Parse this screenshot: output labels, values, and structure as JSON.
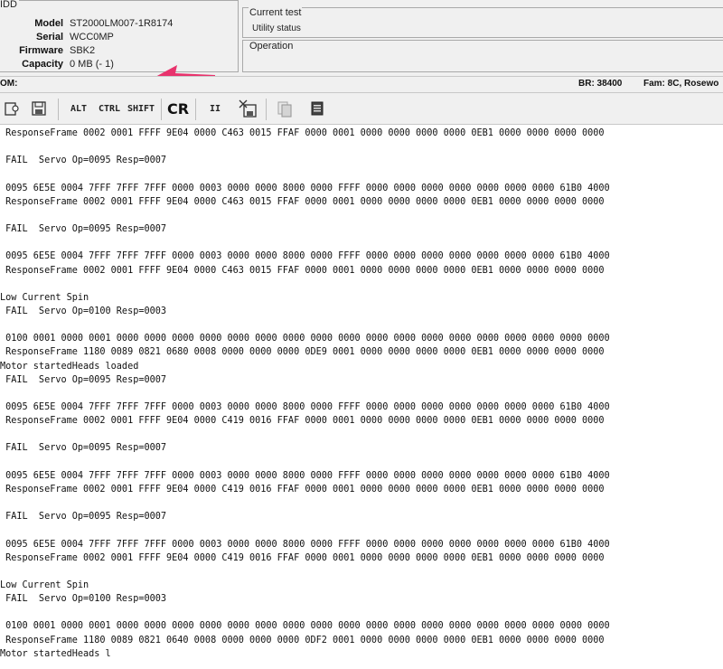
{
  "hdd": {
    "title": "IDD",
    "fields": [
      {
        "label": "Model",
        "value": "ST2000LM007-1R8174"
      },
      {
        "label": "Serial",
        "value": "WCC0MP"
      },
      {
        "label": "Firmware",
        "value": "SBK2"
      },
      {
        "label": "Capacity",
        "value": "0 MB (-      1)"
      }
    ]
  },
  "current_test": {
    "title": "Current test",
    "status": "Utility status"
  },
  "operation": {
    "title": "Operation"
  },
  "status_bar": {
    "com": "OM:",
    "br": "BR: 38400",
    "fam": "Fam: 8C, Rosewo"
  },
  "toolbar": {
    "alt": "ALT",
    "ctrl": "CTRL",
    "shift": "SHIFT",
    "cr": "CR",
    "pause": "II"
  },
  "colors": {
    "arrow": "#e8336d",
    "panel_bg": "#f0f0f0"
  },
  "log": [
    " ResponseFrame 0002 0001 FFFF 9E04 0000 C463 0015 FFAF 0000 0001 0000 0000 0000 0000 0EB1 0000 0000 0000 0000",
    "",
    " FAIL  Servo Op=0095 Resp=0007",
    "",
    " 0095 6E5E 0004 7FFF 7FFF 7FFF 0000 0003 0000 0000 8000 0000 FFFF 0000 0000 0000 0000 0000 0000 0000 61B0 4000",
    " ResponseFrame 0002 0001 FFFF 9E04 0000 C463 0015 FFAF 0000 0001 0000 0000 0000 0000 0EB1 0000 0000 0000 0000",
    "",
    " FAIL  Servo Op=0095 Resp=0007",
    "",
    " 0095 6E5E 0004 7FFF 7FFF 7FFF 0000 0003 0000 0000 8000 0000 FFFF 0000 0000 0000 0000 0000 0000 0000 61B0 4000",
    " ResponseFrame 0002 0001 FFFF 9E04 0000 C463 0015 FFAF 0000 0001 0000 0000 0000 0000 0EB1 0000 0000 0000 0000",
    "",
    "Low Current Spin",
    " FAIL  Servo Op=0100 Resp=0003",
    "",
    " 0100 0001 0000 0001 0000 0000 0000 0000 0000 0000 0000 0000 0000 0000 0000 0000 0000 0000 0000 0000 0000 0000",
    " ResponseFrame 1180 0089 0821 0680 0008 0000 0000 0000 0DE9 0001 0000 0000 0000 0000 0EB1 0000 0000 0000 0000",
    "Motor startedHeads loaded",
    " FAIL  Servo Op=0095 Resp=0007",
    "",
    " 0095 6E5E 0004 7FFF 7FFF 7FFF 0000 0003 0000 0000 8000 0000 FFFF 0000 0000 0000 0000 0000 0000 0000 61B0 4000",
    " ResponseFrame 0002 0001 FFFF 9E04 0000 C419 0016 FFAF 0000 0001 0000 0000 0000 0000 0EB1 0000 0000 0000 0000",
    "",
    " FAIL  Servo Op=0095 Resp=0007",
    "",
    " 0095 6E5E 0004 7FFF 7FFF 7FFF 0000 0003 0000 0000 8000 0000 FFFF 0000 0000 0000 0000 0000 0000 0000 61B0 4000",
    " ResponseFrame 0002 0001 FFFF 9E04 0000 C419 0016 FFAF 0000 0001 0000 0000 0000 0000 0EB1 0000 0000 0000 0000",
    "",
    " FAIL  Servo Op=0095 Resp=0007",
    "",
    " 0095 6E5E 0004 7FFF 7FFF 7FFF 0000 0003 0000 0000 8000 0000 FFFF 0000 0000 0000 0000 0000 0000 0000 61B0 4000",
    " ResponseFrame 0002 0001 FFFF 9E04 0000 C419 0016 FFAF 0000 0001 0000 0000 0000 0000 0EB1 0000 0000 0000 0000",
    "",
    "Low Current Spin",
    " FAIL  Servo Op=0100 Resp=0003",
    "",
    " 0100 0001 0000 0001 0000 0000 0000 0000 0000 0000 0000 0000 0000 0000 0000 0000 0000 0000 0000 0000 0000 0000",
    " ResponseFrame 1180 0089 0821 0640 0008 0000 0000 0000 0DF2 0001 0000 0000 0000 0000 0EB1 0000 0000 0000 0000",
    "Motor startedHeads l"
  ]
}
